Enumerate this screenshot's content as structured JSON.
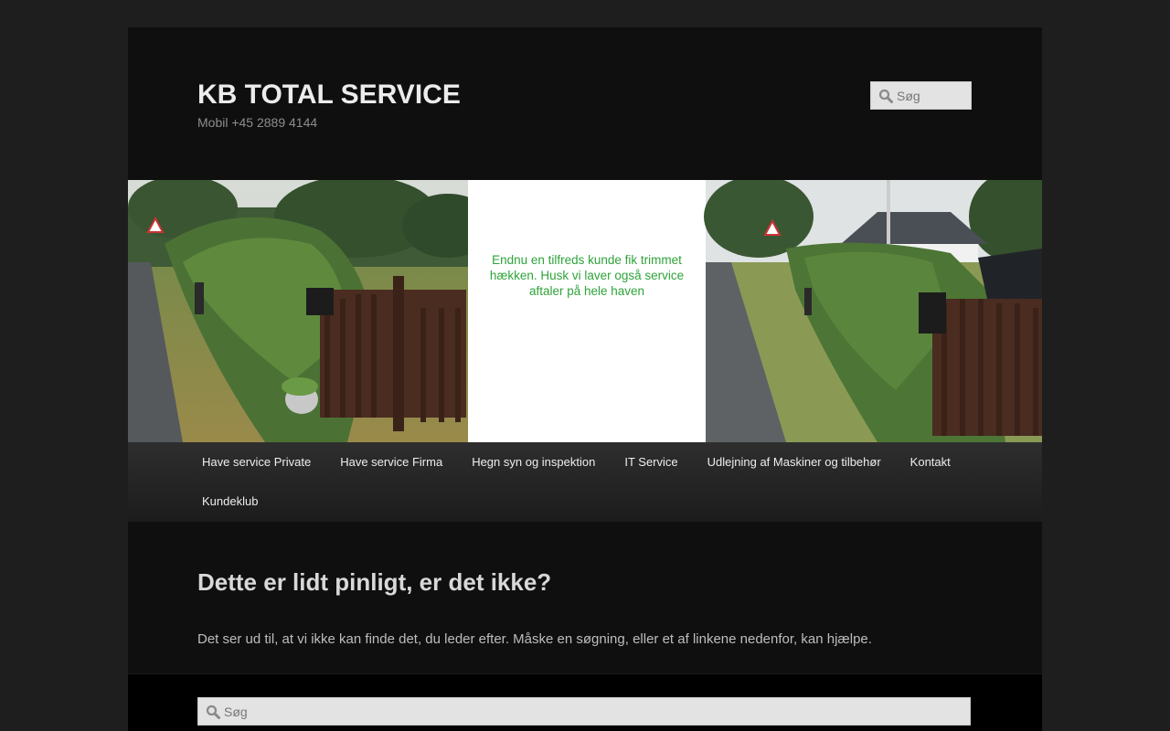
{
  "site": {
    "title": "KB TOTAL SERVICE",
    "description": "Mobil +45 2889 4144"
  },
  "header_search": {
    "placeholder": "Søg"
  },
  "banner": {
    "caption_lines": [
      "Endnu en tilfreds kunde fik trimmet",
      "hækken. Husk vi laver også service",
      "aftaler på hele haven"
    ],
    "caption_color": "#2fa33a"
  },
  "nav": {
    "items": [
      {
        "label": "Have service Private"
      },
      {
        "label": "Have service Firma"
      },
      {
        "label": "Hegn syn og inspektion"
      },
      {
        "label": "IT Service"
      },
      {
        "label": "Udlejning af Maskiner og tilbehør"
      },
      {
        "label": "Kontakt"
      },
      {
        "label": "Kundeklub"
      }
    ]
  },
  "error_page": {
    "title": "Dette er lidt pinligt, er det ikke?",
    "text": "Det ser ud til, at vi ikke kan finde det, du leder efter. Måske en søgning, eller et af linkene nedenfor, kan hjælpe."
  },
  "content_search": {
    "placeholder": "Søg"
  },
  "icons": {
    "search": "magnifier-icon"
  }
}
